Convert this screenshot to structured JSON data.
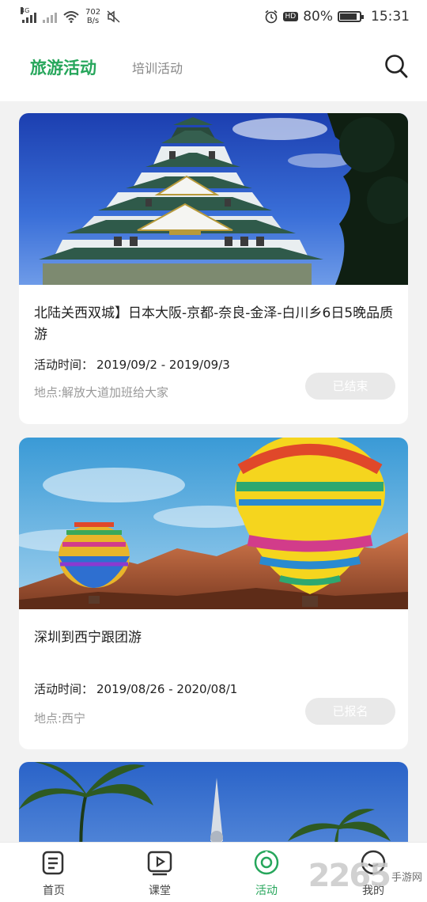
{
  "status_bar": {
    "network": "4G",
    "speed_value": "702",
    "speed_unit": "B/s",
    "battery": "80%",
    "time": "15:31",
    "hd": "HD"
  },
  "header": {
    "tab_active": "旅游活动",
    "tab_other": "培训活动"
  },
  "activities": [
    {
      "title": "北陆关西双城】日本大阪-京都-奈良-金泽-白川乡6日5晚品质游",
      "time_label": "活动时间：",
      "time_value": "2019/09/2 - 2019/09/3",
      "place": "地点:解放大道加班给大家",
      "status": "已结束"
    },
    {
      "title": "深圳到西宁跟团游",
      "time_label": "活动时间：",
      "time_value": "2019/08/26 - 2020/08/1",
      "place": "地点:西宁",
      "status": "已报名"
    }
  ],
  "bottom_nav": {
    "home": "首页",
    "classroom": "课堂",
    "activity": "活动",
    "mine": "我的"
  },
  "watermark": {
    "number": "2265",
    "text": "手游网"
  },
  "colors": {
    "accent": "#26a65b",
    "status_badge": "#e9e9e9"
  }
}
